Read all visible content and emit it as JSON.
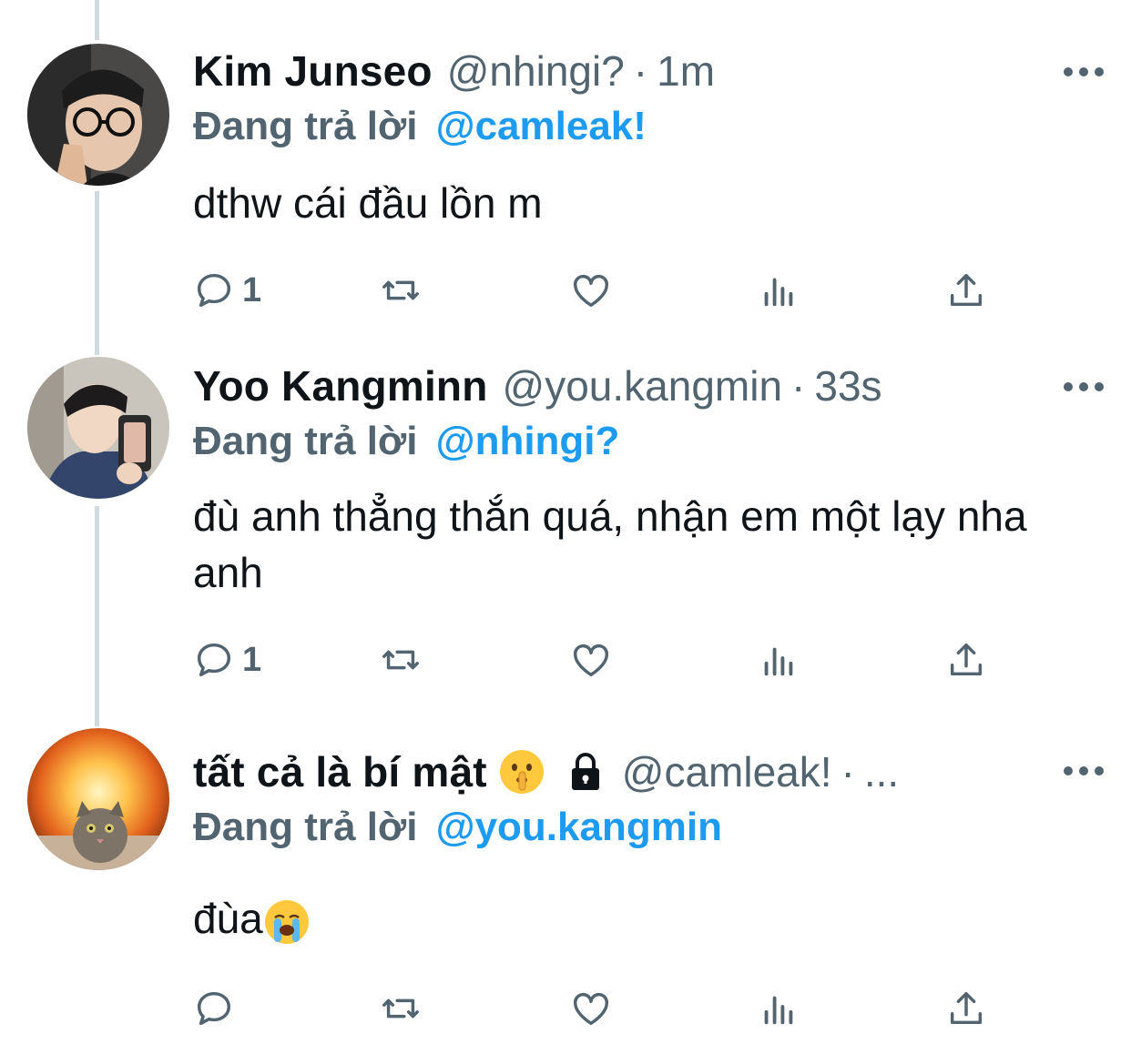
{
  "tweets": [
    {
      "name": "Kim Junseo",
      "handle": "@nhingi?",
      "separator": "·",
      "time": "1m",
      "reply_prefix": "Đang trả lời",
      "reply_to": "@camleak!",
      "text": "dthw cái đầu lồn m",
      "reply_count": "1"
    },
    {
      "name": "Yoo Kangminn",
      "handle": "@you.kangmin",
      "separator": "·",
      "time": "33s",
      "reply_prefix": "Đang trả lời",
      "reply_to": "@nhingi?",
      "text": "đù anh thẳng thắn quá, nhận em một lạy nha anh",
      "reply_count": "1"
    },
    {
      "name": "tất cả là bí mật",
      "name_emojis": [
        "shushing-face-emoji",
        "lock-icon"
      ],
      "handle": "@camleak!",
      "separator": "·",
      "time": "...",
      "reply_prefix": "Đang trả lời",
      "reply_to": "@you.kangmin",
      "text": "đùa",
      "text_emoji": "loudly-crying-face-emoji",
      "reply_count": ""
    }
  ],
  "icons": [
    "reply-icon",
    "retweet-icon",
    "like-icon",
    "analytics-icon",
    "share-icon",
    "more-icon"
  ],
  "colors": {
    "link": "#1d9bf0",
    "secondary": "#536471",
    "text": "#0f1419",
    "thread_line": "#cfd9de"
  }
}
